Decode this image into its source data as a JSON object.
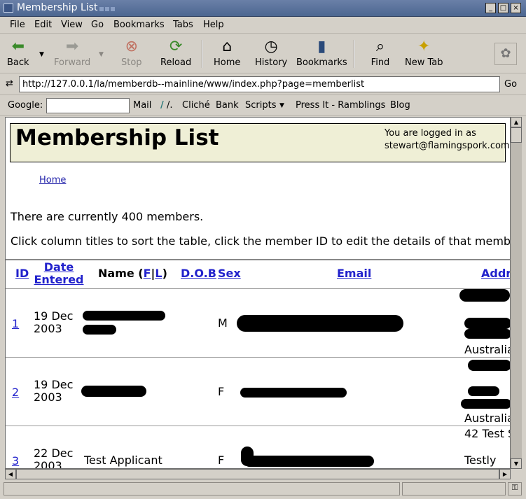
{
  "window": {
    "title": "Membership List"
  },
  "menu": [
    "File",
    "Edit",
    "View",
    "Go",
    "Bookmarks",
    "Tabs",
    "Help"
  ],
  "toolbar": {
    "back": "Back",
    "forward": "Forward",
    "stop": "Stop",
    "reload": "Reload",
    "home": "Home",
    "history": "History",
    "bookmarks": "Bookmarks",
    "find": "Find",
    "new_tab": "New Tab"
  },
  "address": {
    "url": "http://127.0.0.1/la/memberdb--mainline/www/index.php?page=memberlist",
    "go": "Go"
  },
  "links_bar": {
    "google_label": "Google:",
    "items": [
      "Mail",
      "/.",
      "Cliché",
      "Bank",
      "Scripts",
      "Press It - Ramblings",
      "Blog"
    ]
  },
  "page": {
    "heading": "Membership List",
    "logged_in_line1": "You are logged in as",
    "logged_in_line2": "stewart@flamingspork.com",
    "breadcrumb": "Home",
    "member_count_text": "There are currently 400 members.",
    "instructions": "Click column titles to sort the table, click the member ID to edit the details of that member"
  },
  "table": {
    "headers": {
      "id": "ID",
      "date_1": "Date",
      "date_2": "Entered",
      "name_prefix": "Name (",
      "name_f": "F",
      "name_sep": "|",
      "name_l": "L",
      "name_suffix": ")",
      "dob": "D.O.B",
      "sex": "Sex",
      "email": "Email",
      "address": "Addr"
    },
    "rows": [
      {
        "id": "1",
        "date_1": "19 Dec",
        "date_2": "2003",
        "name": "",
        "sex": "M",
        "address_last": "Australia"
      },
      {
        "id": "2",
        "date_1": "19 Dec",
        "date_2": "2003",
        "name": "",
        "sex": "F",
        "address_last": "Australia"
      },
      {
        "id": "3",
        "date_1": "22 Dec",
        "date_2": "2003",
        "name": "Test Applicant",
        "sex": "F",
        "address_1": "42 Test S",
        "address_2": "Testly"
      }
    ]
  }
}
